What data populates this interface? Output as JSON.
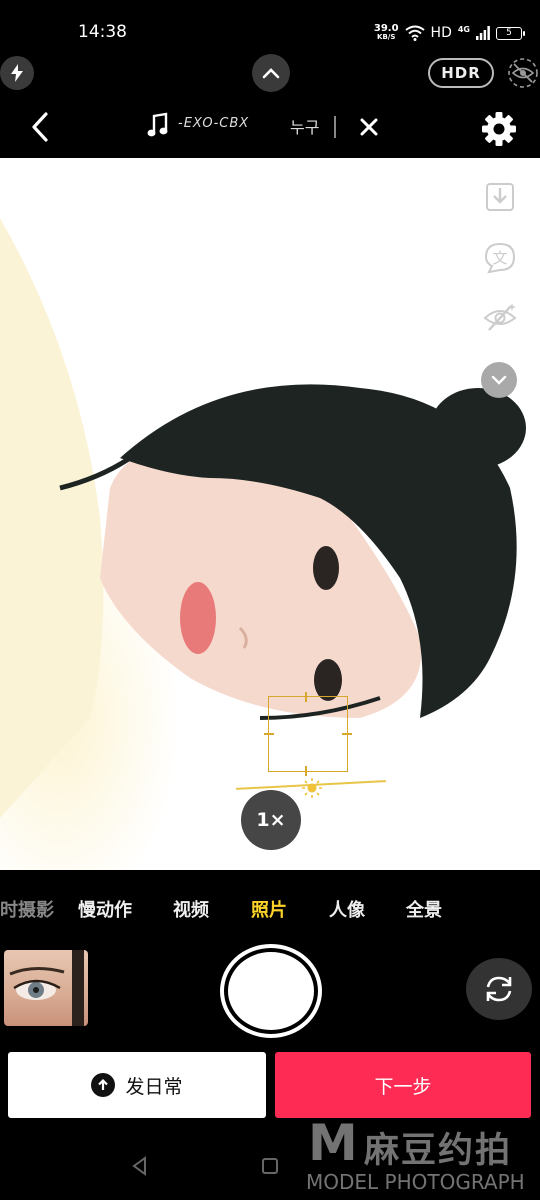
{
  "status_bar": {
    "time": "14:38",
    "net_speed_value": "39.0",
    "net_speed_unit": "KB/S",
    "network_label": "HD",
    "signal_label": "4G",
    "battery_level": "5"
  },
  "camera_top": {
    "hdr_label": "HDR",
    "music_title": "-EXO-CBX",
    "music_title_extra": "누구"
  },
  "zoom_level": "1×",
  "modes": [
    {
      "label": "时摄影",
      "state": "faded"
    },
    {
      "label": "慢动作",
      "state": "normal"
    },
    {
      "label": "视频",
      "state": "normal"
    },
    {
      "label": "照片",
      "state": "active"
    },
    {
      "label": "人像",
      "state": "normal"
    },
    {
      "label": "全景",
      "state": "normal"
    }
  ],
  "actions": {
    "post_label": "发日常",
    "next_label": "下一步"
  },
  "watermark": {
    "logo_letter": "M",
    "cn_text": "麻豆约拍",
    "en_text": "MODEL PHOTOGRAPH"
  },
  "colors": {
    "accent_mode": "#ffd42a",
    "next_button": "#fe2c55",
    "focus_box": "#d6a72a"
  },
  "icons": [
    "flash-icon",
    "chevron-up-icon",
    "eye-off-icon",
    "back-arrow-icon",
    "music-note-icon",
    "close-icon",
    "gear-icon",
    "download-icon",
    "translate-icon",
    "beauty-eye-icon",
    "chevron-down-icon",
    "camera-flip-icon",
    "upload-arrow-icon"
  ]
}
